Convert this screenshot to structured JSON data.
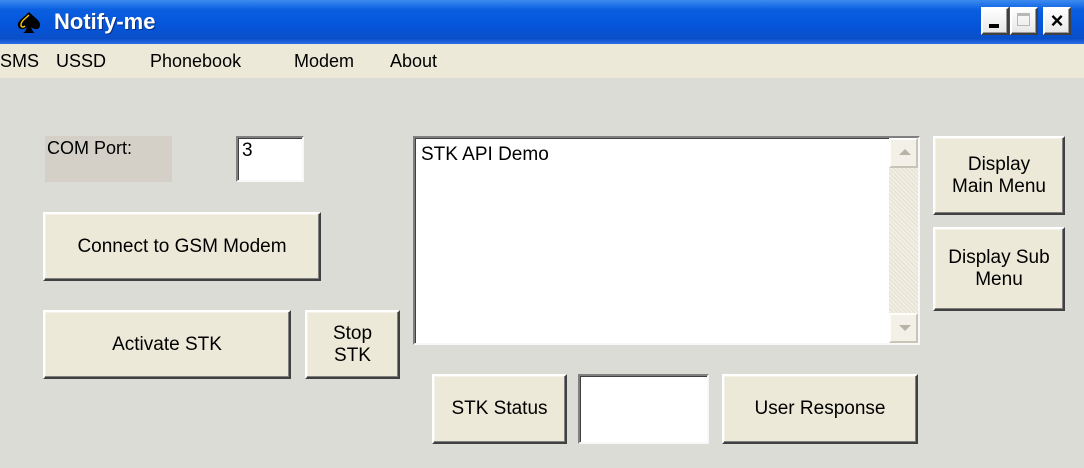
{
  "window": {
    "title": "Notify-me",
    "app_icon": "spade-icon",
    "controls": {
      "minimize_icon": "minimize-icon",
      "maximize_icon": "maximize-icon",
      "close_icon": "close-icon"
    }
  },
  "menu": {
    "items": [
      {
        "label": "SMS"
      },
      {
        "label": "USSD"
      },
      {
        "label": "Phonebook"
      },
      {
        "label": "Modem"
      },
      {
        "label": "About"
      }
    ]
  },
  "form": {
    "com_port_label": "COM Port:",
    "com_port_value": "3",
    "connect_label": "Connect to GSM Modem",
    "activate_stk_label": "Activate STK",
    "stop_stk_label_line1": "Stop",
    "stop_stk_label_line2": "STK",
    "output_text": "STK API Demo",
    "display_main_menu_line1": "Display",
    "display_main_menu_line2": "Main Menu",
    "display_sub_menu_line1": "Display Sub",
    "display_sub_menu_line2": "Menu",
    "stk_status_label": "STK Status",
    "stk_status_value": "",
    "user_response_label": "User Response"
  },
  "colors": {
    "titlebar": "#0554d9",
    "window_bg": "#ece9d8",
    "client_bg": "#dcdcd6"
  }
}
